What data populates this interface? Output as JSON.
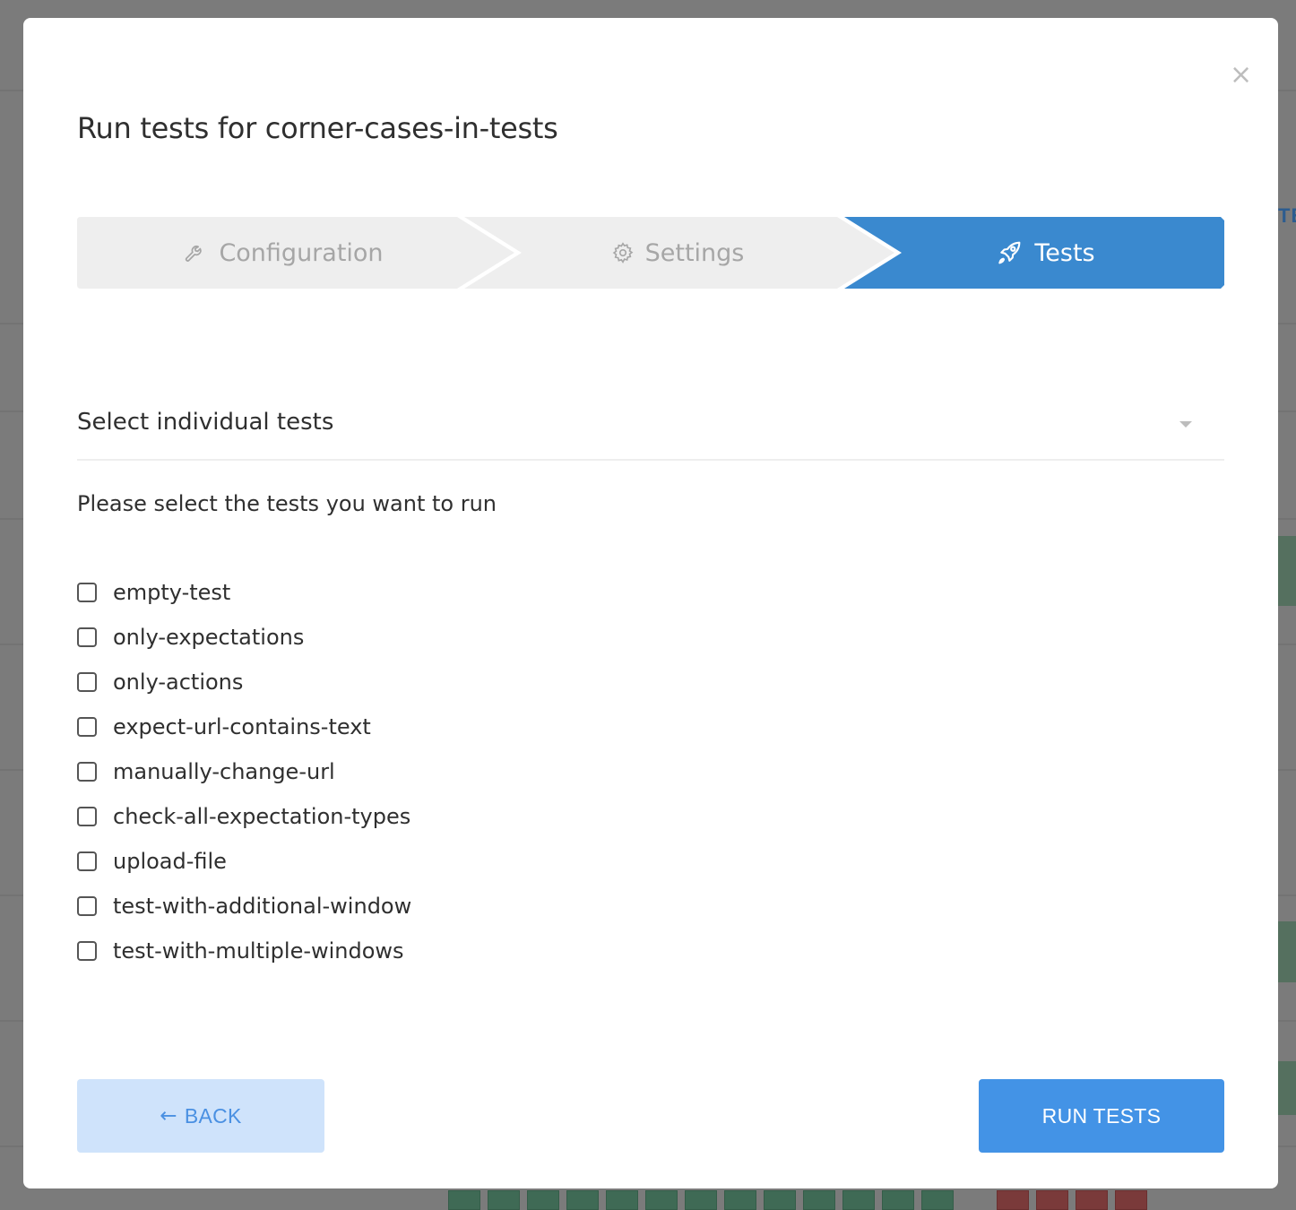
{
  "modal": {
    "title": "Run tests for corner-cases-in-tests",
    "close_icon": "close-icon"
  },
  "stepper": {
    "steps": [
      {
        "label": "Configuration",
        "icon": "wrench-icon",
        "state": "inactive"
      },
      {
        "label": "Settings",
        "icon": "gear-icon",
        "state": "inactive"
      },
      {
        "label": "Tests",
        "icon": "rocket-icon",
        "state": "active"
      }
    ],
    "colors": {
      "inactive_bg": "#eeeeee",
      "active_bg": "#3a89cf"
    }
  },
  "selector": {
    "label": "Select individual tests"
  },
  "instruction": "Please select the tests you want to run",
  "tests": [
    {
      "name": "empty-test",
      "checked": false
    },
    {
      "name": "only-expectations",
      "checked": false
    },
    {
      "name": "only-actions",
      "checked": false
    },
    {
      "name": "expect-url-contains-text",
      "checked": false
    },
    {
      "name": "manually-change-url",
      "checked": false
    },
    {
      "name": "check-all-expectation-types",
      "checked": false
    },
    {
      "name": "upload-file",
      "checked": false
    },
    {
      "name": "test-with-additional-window",
      "checked": false
    },
    {
      "name": "test-with-multiple-windows",
      "checked": false
    }
  ],
  "footer": {
    "back_arrow": "←",
    "back_label": "BACK",
    "run_label": "RUN TESTS"
  },
  "background": {
    "edge_text": "TE"
  }
}
